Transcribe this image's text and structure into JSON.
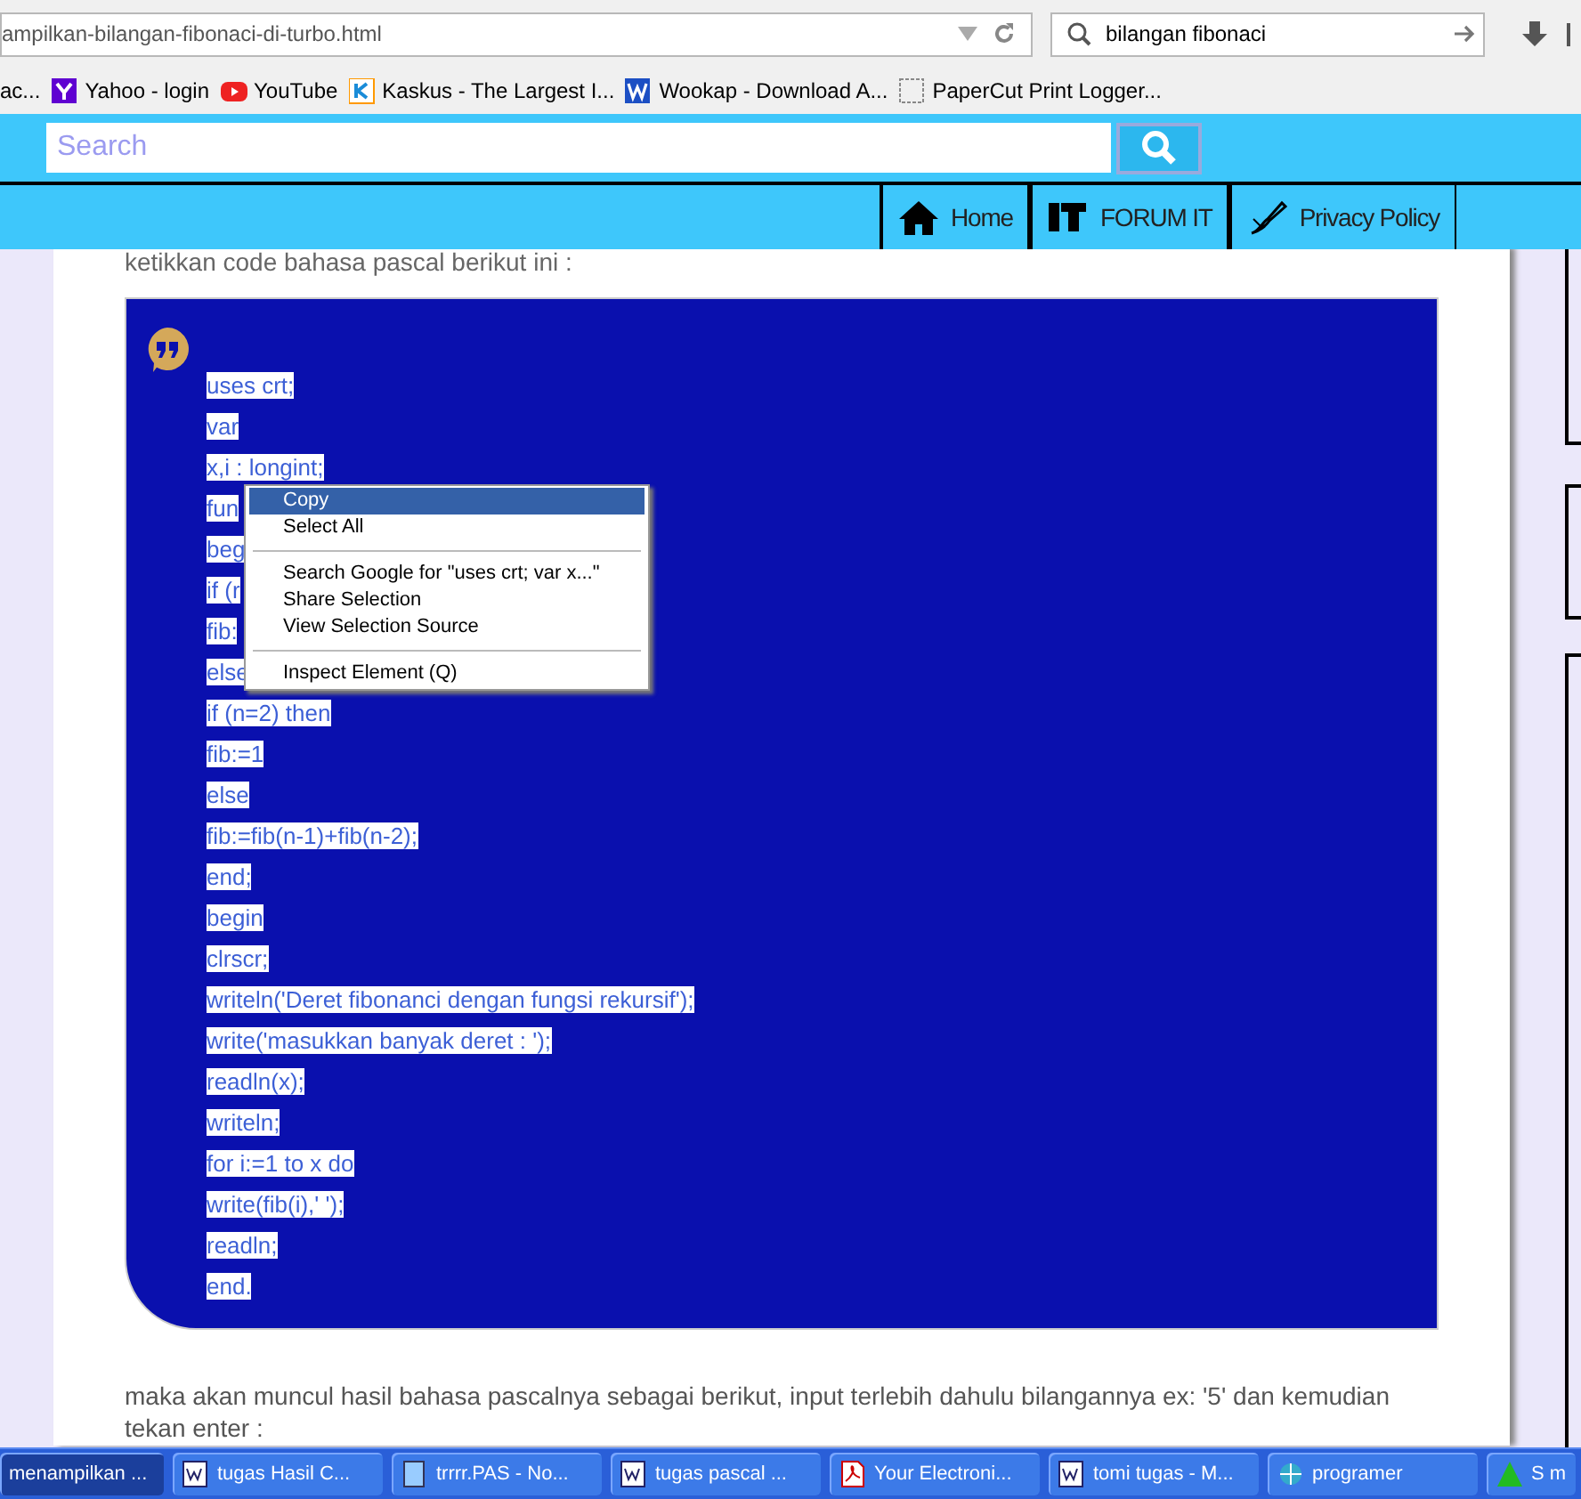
{
  "browser": {
    "url": "ampilkan-bilangan-fibonaci-di-turbo.html",
    "search": "bilangan fibonaci",
    "bookmarks": [
      {
        "label": "ac..."
      },
      {
        "label": "Yahoo - login"
      },
      {
        "label": "YouTube"
      },
      {
        "label": "Kaskus - The Largest I..."
      },
      {
        "label": "Wookap - Download A..."
      },
      {
        "label": "PaperCut Print Logger..."
      }
    ]
  },
  "header": {
    "search_placeholder": "Search",
    "nav": [
      {
        "label": "Home"
      },
      {
        "label": "FORUM IT"
      },
      {
        "label": "Privacy Policy"
      }
    ]
  },
  "article": {
    "intro": "ketikkan code bahasa pascal berikut ini :",
    "code_lines": [
      "uses crt;",
      "var",
      "x,i : longint;",
      "fun",
      "beg",
      "if (r",
      "fib:",
      "else",
      "if (n=2) then",
      "fib:=1",
      "else",
      "fib:=fib(n-1)+fib(n-2);",
      "end;",
      "begin",
      "clrscr;",
      "writeln('Deret fibonanci dengan fungsi rekursif');",
      "write('masukkan banyak deret : ');",
      "readln(x);",
      "writeln;",
      "for i:=1 to x do",
      "write(fib(i),' ');",
      "readln;",
      "end."
    ],
    "outro": "maka akan muncul hasil bahasa pascalnya sebagai berikut, input terlebih dahulu bilangannya ex: '5' dan kemudian tekan enter :"
  },
  "context_menu": [
    {
      "kind": "item",
      "label": "Copy",
      "selected": true
    },
    {
      "kind": "item",
      "label": "Select All",
      "selected": false
    },
    {
      "kind": "separator"
    },
    {
      "kind": "item",
      "label": "Search Google for \"uses crt; var x...\"",
      "selected": false
    },
    {
      "kind": "item",
      "label": "Share Selection",
      "selected": false
    },
    {
      "kind": "item",
      "label": "View Selection Source",
      "selected": false
    },
    {
      "kind": "separator"
    },
    {
      "kind": "item",
      "label": "Inspect Element (Q)",
      "selected": false
    }
  ],
  "taskbar": [
    {
      "label": "menampilkan ...",
      "selected": true
    },
    {
      "label": "tugas Hasil C...",
      "selected": false
    },
    {
      "label": "trrrr.PAS - No...",
      "selected": false
    },
    {
      "label": "tugas pascal ...",
      "selected": false
    },
    {
      "label": "Your Electroni...",
      "selected": false
    },
    {
      "label": "tomi tugas - M...",
      "selected": false
    },
    {
      "label": "programer",
      "selected": false
    },
    {
      "label": "S  m",
      "selected": false
    }
  ]
}
